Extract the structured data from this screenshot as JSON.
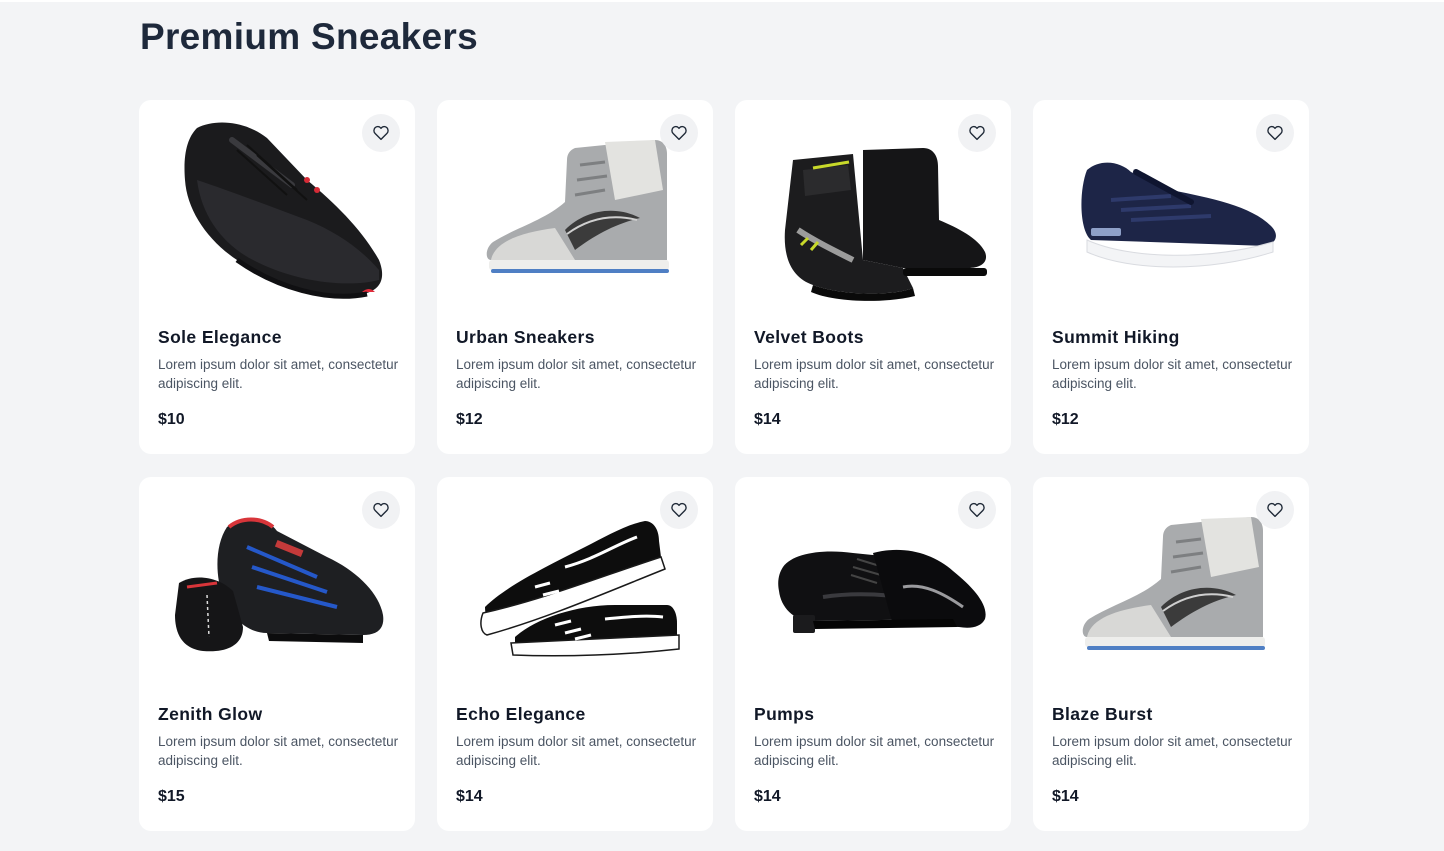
{
  "page": {
    "title": "Premium Sneakers"
  },
  "products": [
    {
      "name": "Sole Elegance",
      "description": "Lorem ipsum dolor sit amet, consectetur adipiscing elit.",
      "price": "$10",
      "image": "black-lowtop-shoe"
    },
    {
      "name": "Urban Sneakers",
      "description": "Lorem ipsum dolor sit amet, consectetur adipiscing elit.",
      "price": "$12",
      "image": "grey-hightop-sneaker"
    },
    {
      "name": "Velvet Boots",
      "description": "Lorem ipsum dolor sit amet, consectetur adipiscing elit.",
      "price": "$14",
      "image": "black-moto-boot"
    },
    {
      "name": "Summit Hiking",
      "description": "Lorem ipsum dolor sit amet, consectetur adipiscing elit.",
      "price": "$12",
      "image": "navy-runner"
    },
    {
      "name": "Zenith Glow",
      "description": "Lorem ipsum dolor sit amet, consectetur adipiscing elit.",
      "price": "$15",
      "image": "black-blue-work-shoe-pair"
    },
    {
      "name": "Echo Elegance",
      "description": "Lorem ipsum dolor sit amet, consectetur adipiscing elit.",
      "price": "$14",
      "image": "black-white-canvas-pair"
    },
    {
      "name": "Pumps",
      "description": "Lorem ipsum dolor sit amet, consectetur adipiscing elit.",
      "price": "$14",
      "image": "patent-leather-pair"
    },
    {
      "name": "Blaze Burst",
      "description": "Lorem ipsum dolor sit amet, consectetur adipiscing elit.",
      "price": "$14",
      "image": "grey-hightop-sneaker"
    }
  ],
  "icons": {
    "favorite": "heart-outline-icon"
  },
  "colors": {
    "background": "#f3f4f6",
    "card": "#ffffff",
    "title": "#1e293b",
    "text_muted": "#4b5563"
  }
}
